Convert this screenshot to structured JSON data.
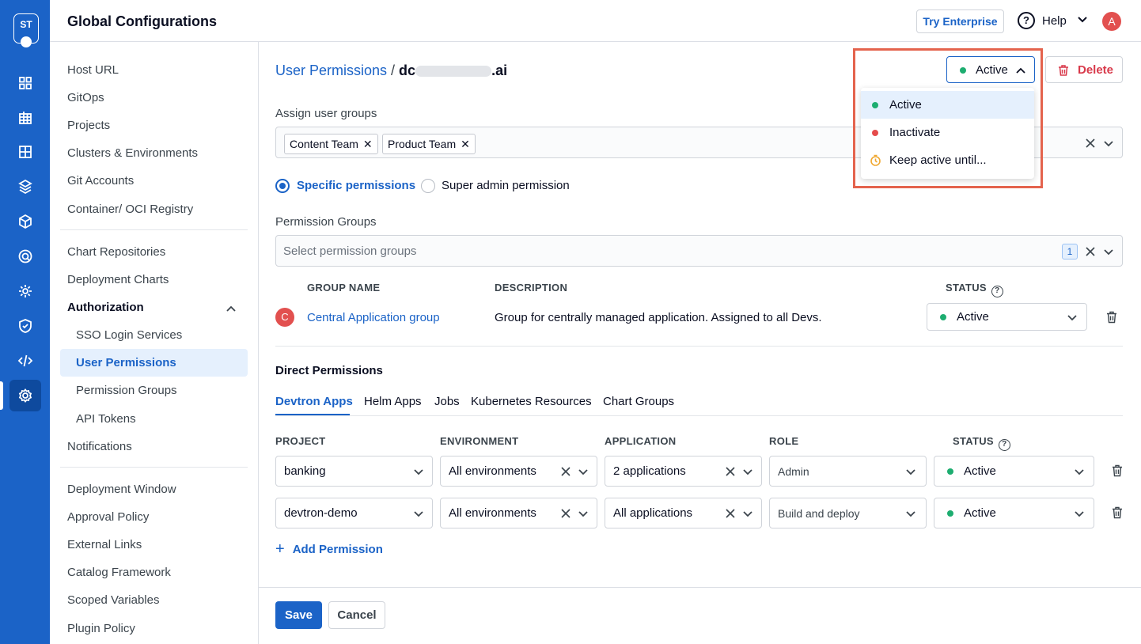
{
  "rail": {
    "logo_text": "ST",
    "icons": [
      "overview-icon",
      "applications-icon",
      "app-groups-icon",
      "jobs-icon",
      "resource-browser-icon",
      "security-scan-icon",
      "bulk-edit-icon",
      "security-icon",
      "code-icon",
      "settings-icon"
    ],
    "active": "settings-icon"
  },
  "header": {
    "title": "Global Configurations",
    "try_enterprise": "Try Enterprise",
    "help": "Help",
    "help_icon_text": "?",
    "avatar": "A"
  },
  "subnav": {
    "items": [
      "Host URL",
      "GitOps",
      "Projects",
      "Clusters & Environments",
      "Git Accounts",
      "Container/ OCI Registry",
      "Chart Repositories",
      "Deployment Charts",
      "Authorization",
      "SSO Login Services",
      "User Permissions",
      "Permission Groups",
      "API Tokens",
      "Notifications",
      "Deployment Window",
      "Approval Policy",
      "External Links",
      "Catalog Framework",
      "Scoped Variables",
      "Plugin Policy"
    ],
    "selected": "User Permissions"
  },
  "breadcrumb": {
    "parent": "User Permissions",
    "separator": " / ",
    "email_start": "dc",
    "email_end": ".ai"
  },
  "status_button": {
    "label": "Active"
  },
  "delete_button": {
    "label": "Delete"
  },
  "status_menu": {
    "items": [
      {
        "label": "Active",
        "color": "#1dad70"
      },
      {
        "label": "Inactivate",
        "color": "#e54b4b"
      },
      {
        "label": "Keep active until...",
        "color": "#f0a830"
      }
    ],
    "highlighted": "Active"
  },
  "assign_groups": {
    "label": "Assign user groups",
    "chips": [
      "Content Team",
      "Product Team"
    ]
  },
  "permission_type": {
    "options": [
      "Specific permissions",
      "Super admin permission"
    ],
    "selected": "Specific permissions"
  },
  "permission_groups": {
    "label": "Permission Groups",
    "placeholder": "Select permission groups",
    "count": "1",
    "columns": [
      "GROUP NAME",
      "DESCRIPTION",
      "STATUS"
    ],
    "rows": [
      {
        "initial": "C",
        "name": "Central Application group",
        "description": "Group for centrally managed application. Assigned to all Devs.",
        "status": "Active"
      }
    ]
  },
  "direct_permissions": {
    "title": "Direct Permissions",
    "tabs": [
      "Devtron Apps",
      "Helm Apps",
      "Jobs",
      "Kubernetes Resources",
      "Chart Groups"
    ],
    "active_tab": "Devtron Apps",
    "columns": [
      "PROJECT",
      "ENVIRONMENT",
      "APPLICATION",
      "ROLE",
      "STATUS"
    ],
    "rows": [
      {
        "project": "banking",
        "environment": "All environments",
        "application": "2 applications",
        "role": "Admin",
        "status": "Active"
      },
      {
        "project": "devtron-demo",
        "environment": "All environments",
        "application": "All applications",
        "role": "Build and deploy",
        "status": "Active"
      }
    ],
    "add_label": "Add Permission",
    "add_icon": "+"
  },
  "footer": {
    "save": "Save",
    "cancel": "Cancel"
  },
  "colors": {
    "brand": "#1b63c7",
    "active": "#1dad70",
    "danger": "#d8394a",
    "highlight": "#e4634d"
  }
}
